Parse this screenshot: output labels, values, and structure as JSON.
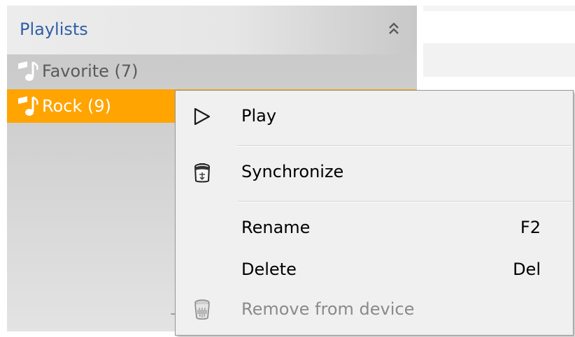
{
  "playlists_panel": {
    "title": "Playlists",
    "collapse_icon": "double-chevron-up-icon",
    "items": [
      {
        "label": "Favorite (7)",
        "icon": "music-note-icon",
        "selected": false
      },
      {
        "label": "Rock (9)",
        "icon": "music-note-icon",
        "selected": true
      }
    ],
    "bottom_mark": "+"
  },
  "context_menu": {
    "items": [
      {
        "label": "Play",
        "icon": "play-outline-icon",
        "shortcut": "",
        "enabled": true
      },
      {
        "label": "Synchronize",
        "icon": "sync-device-icon",
        "shortcut": "",
        "enabled": true
      },
      {
        "label": "Rename",
        "icon": "",
        "shortcut": "F2",
        "enabled": true
      },
      {
        "label": "Delete",
        "icon": "",
        "shortcut": "Del",
        "enabled": true
      },
      {
        "label": "Remove from device",
        "icon": "trash-can-icon",
        "shortcut": "",
        "enabled": false
      }
    ]
  },
  "colors": {
    "selected_row": "#ffa400",
    "title_text": "#2f5fa8",
    "menu_background": "#f0f0f0",
    "disabled_text": "#8a8a8a"
  }
}
